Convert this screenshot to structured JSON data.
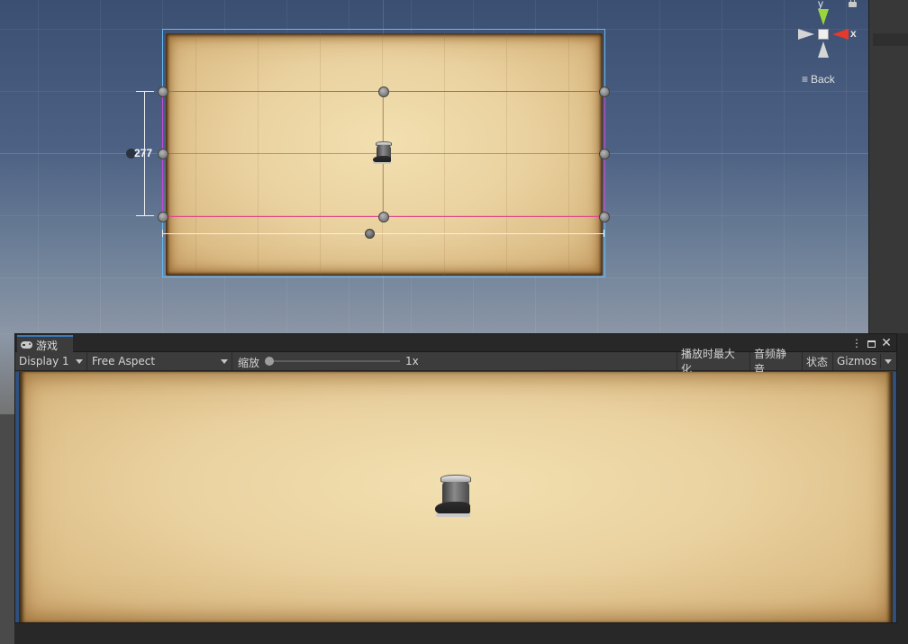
{
  "scene": {
    "rect_height_label": "277",
    "gizmo": {
      "y_label": "y",
      "x_label": "x",
      "back_label": "Back",
      "y_color": "#9bd53c",
      "x_color": "#e5392c"
    },
    "selection_color": "#e0458a",
    "canvas_border_color": "#67b8ee"
  },
  "game_view": {
    "tab_label": "游戏",
    "window_buttons": [
      "kebab-icon",
      "maximize-icon",
      "close-icon"
    ],
    "toolbar": {
      "display_selected": "Display 1",
      "aspect_selected": "Free Aspect",
      "scale_label": "缩放",
      "scale_value": "1x",
      "scale_fraction": 0,
      "maximize_on_play": "播放时最大化",
      "mute_audio": "音频静音",
      "stats": "状态",
      "gizmos": "Gizmos"
    },
    "tab_accent": "#3a79bb"
  }
}
